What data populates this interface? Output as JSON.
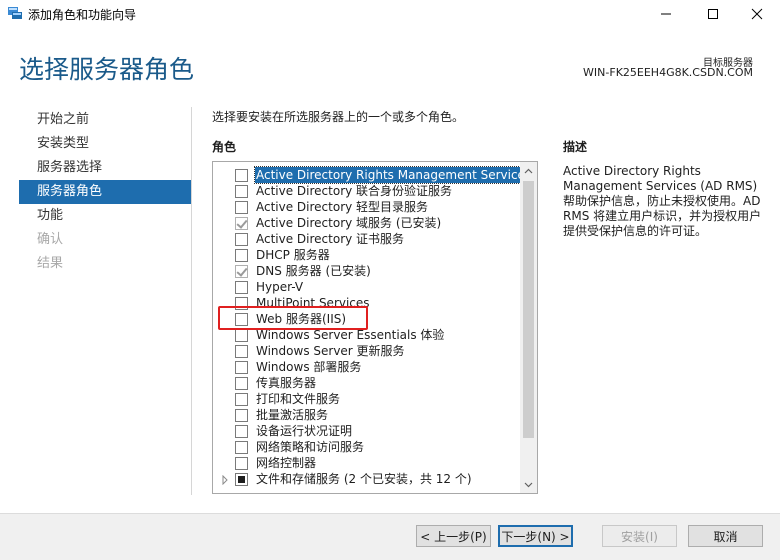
{
  "window": {
    "title": "添加角色和功能向导",
    "controls": [
      "minimize-icon",
      "maximize-icon",
      "close-icon"
    ]
  },
  "header": {
    "title": "选择服务器角色",
    "target_label": "目标服务器",
    "target_server": "WIN-FK25EEH4G8K.CSDN.COM"
  },
  "nav": {
    "items": [
      {
        "label": "开始之前",
        "state": "normal"
      },
      {
        "label": "安装类型",
        "state": "normal"
      },
      {
        "label": "服务器选择",
        "state": "normal"
      },
      {
        "label": "服务器角色",
        "state": "active"
      },
      {
        "label": "功能",
        "state": "normal"
      },
      {
        "label": "确认",
        "state": "disabled"
      },
      {
        "label": "结果",
        "state": "disabled"
      }
    ]
  },
  "main": {
    "instruction": "选择要安装在所选服务器上的一个或多个角色。",
    "roles_label": "角色",
    "roles": [
      {
        "label": "Active Directory Rights Management Services",
        "checked": false,
        "selected": true
      },
      {
        "label": "Active Directory 联合身份验证服务",
        "checked": false
      },
      {
        "label": "Active Directory 轻型目录服务",
        "checked": false
      },
      {
        "label": "Active Directory 域服务 (已安装)",
        "checked": true
      },
      {
        "label": "Active Directory 证书服务",
        "checked": false
      },
      {
        "label": "DHCP 服务器",
        "checked": false
      },
      {
        "label": "DNS 服务器 (已安装)",
        "checked": true
      },
      {
        "label": "Hyper-V",
        "checked": false
      },
      {
        "label": "MultiPoint Services",
        "checked": false
      },
      {
        "label": "Web 服务器(IIS)",
        "checked": false,
        "highlighted": true
      },
      {
        "label": "Windows Server Essentials 体验",
        "checked": false
      },
      {
        "label": "Windows Server 更新服务",
        "checked": false
      },
      {
        "label": "Windows 部署服务",
        "checked": false
      },
      {
        "label": "传真服务器",
        "checked": false
      },
      {
        "label": "打印和文件服务",
        "checked": false
      },
      {
        "label": "批量激活服务",
        "checked": false
      },
      {
        "label": "设备运行状况证明",
        "checked": false
      },
      {
        "label": "网络策略和访问服务",
        "checked": false
      },
      {
        "label": "网络控制器",
        "checked": false
      },
      {
        "label": "文件和存储服务 (2 个已安装，共 12 个)",
        "checked": "partial",
        "expandable": true
      }
    ],
    "description_label": "描述",
    "description_text": "Active Directory Rights Management Services (AD RMS) 帮助保护信息，防止未授权使用。AD RMS 将建立用户标识，并为授权用户提供受保护信息的许可证。"
  },
  "footer": {
    "prev": "< 上一步(P)",
    "next": "下一步(N) >",
    "install": "安装(I)",
    "cancel": "取消"
  },
  "colors": {
    "accent": "#1e6dae",
    "title": "#1a5a8a",
    "highlight": "#e02020"
  }
}
